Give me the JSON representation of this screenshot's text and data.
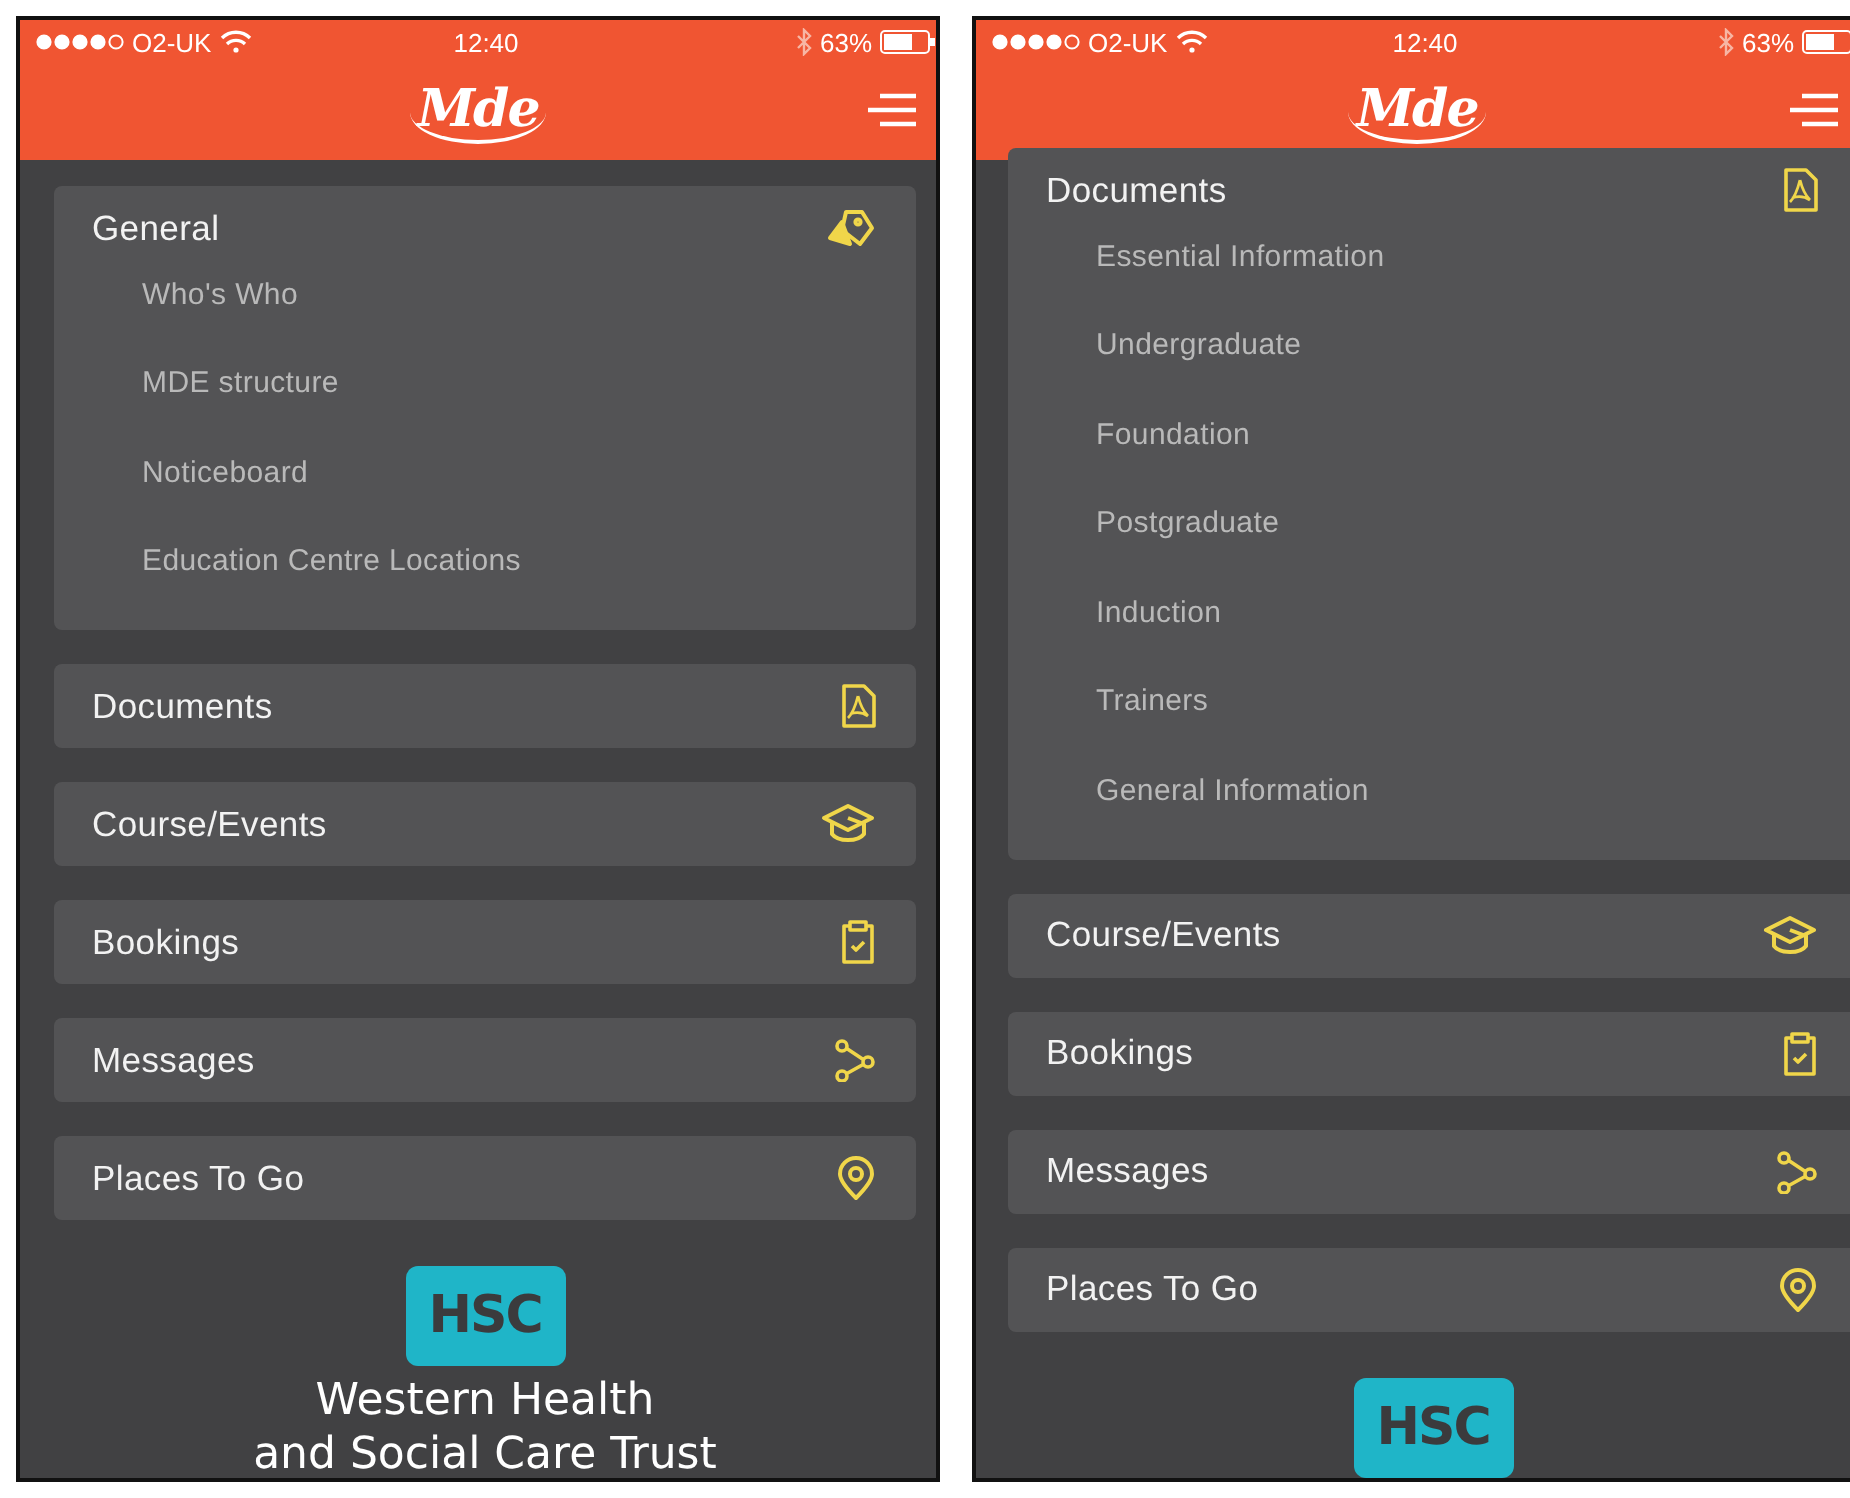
{
  "screens": [
    {
      "status": {
        "carrier": "O2-UK",
        "time": "12:40",
        "battery": "63%"
      },
      "logo": "Mde",
      "menu": [
        {
          "label": "General",
          "kind": "tag",
          "children": [
            {
              "label": "Who's Who"
            },
            {
              "label": "MDE structure"
            },
            {
              "label": "Noticeboard"
            },
            {
              "label": "Education Centre Locations"
            }
          ]
        },
        {
          "label": "Documents",
          "kind": "pdf"
        },
        {
          "label": "Course/Events",
          "kind": "cap"
        },
        {
          "label": "Bookings",
          "kind": "clipboard"
        },
        {
          "label": "Messages",
          "kind": "share"
        },
        {
          "label": "Places To Go",
          "kind": "pin"
        }
      ],
      "footer": {
        "badge": "HSC",
        "lines": [
          "Western Health",
          "and Social Care Trust"
        ]
      }
    },
    {
      "status": {
        "carrier": "O2-UK",
        "time": "12:40",
        "battery": "63%"
      },
      "logo": "Mde",
      "menu": [
        {
          "label": "Documents",
          "kind": "pdf",
          "children": [
            {
              "label": "Essential Information"
            },
            {
              "label": "Undergraduate"
            },
            {
              "label": "Foundation"
            },
            {
              "label": "Postgraduate"
            },
            {
              "label": "Induction"
            },
            {
              "label": "Trainers"
            },
            {
              "label": "General Information"
            }
          ]
        },
        {
          "label": "Course/Events",
          "kind": "cap"
        },
        {
          "label": "Bookings",
          "kind": "clipboard"
        },
        {
          "label": "Messages",
          "kind": "share"
        },
        {
          "label": "Places To Go",
          "kind": "pin"
        }
      ],
      "footer": {
        "badge": "HSC"
      }
    }
  ]
}
